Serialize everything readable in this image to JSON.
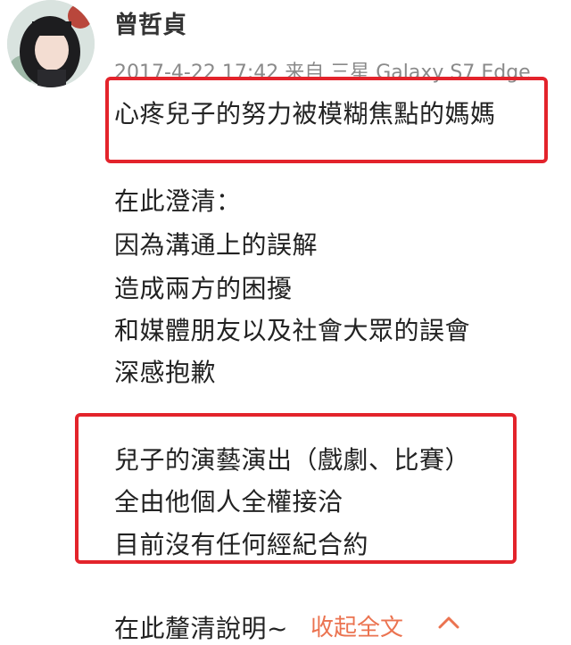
{
  "post": {
    "author": "曾哲貞",
    "meta": "2017-4-22 17:42 来自 三星 Galaxy S7 Edge",
    "headline": "心疼兒子的努力被模糊焦點的媽媽",
    "body_lines": [
      "在此澄清：",
      "因為溝通上的誤解",
      "造成兩方的困擾",
      "和媒體朋友以及社會大眾的誤會",
      "深感抱歉"
    ],
    "highlight_lines": [
      "兒子的演藝演出（戲劇、比賽）",
      "全由他個人全權接洽",
      "目前沒有任何經紀合約"
    ],
    "closing": "在此釐清說明~",
    "collapse_label": "收起全文"
  },
  "colors": {
    "highlight_box": "#e3232b",
    "link": "#eb7350",
    "meta": "#8a8a8a"
  }
}
